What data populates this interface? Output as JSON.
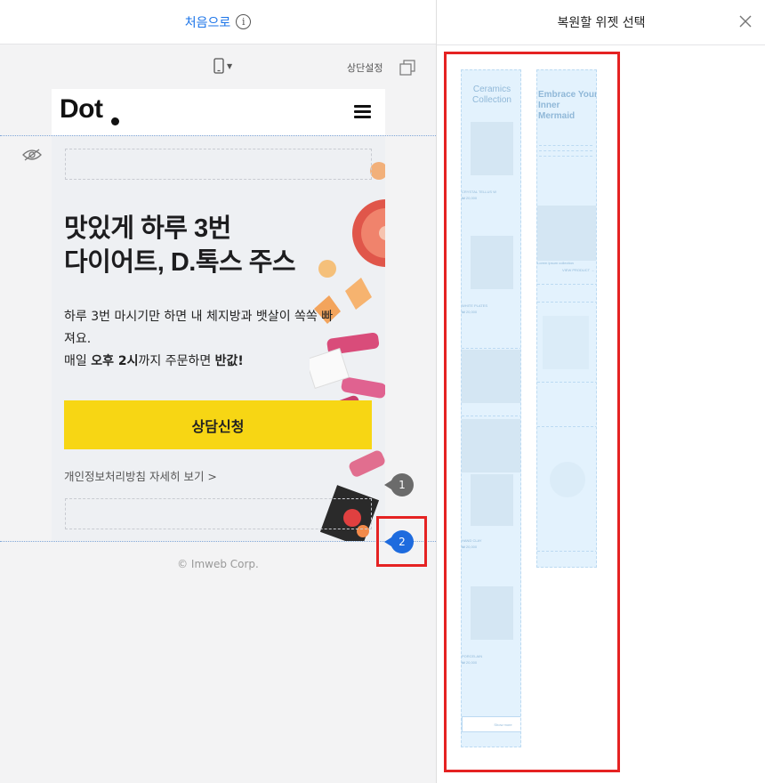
{
  "editor": {
    "start_label": "처음으로",
    "info_icon_glyph": "i",
    "device_icon": "mobile-phone-icon",
    "sticky_label": "상단설정",
    "copy_icon": "copy-icon"
  },
  "site": {
    "logo": "Dot",
    "menu_icon": "hamburger-menu-icon",
    "hero_title_line1": "맛있게 하루 3번",
    "hero_title_line2": "다이어트, D.톡스 주스",
    "desc_line1": "하루 3번 마시기만 하면 내 체지방과 뱃살이 쏙쏙 빠",
    "desc_line2": "져요.",
    "desc_line3_pre": "매일 ",
    "desc_line3_bold1": "오후 2시",
    "desc_line3_mid": "까지 주문하면 ",
    "desc_line3_bold2": "반값!",
    "cta_label": "상담신청",
    "privacy_link": "개인정보처리방침 자세히 보기 >",
    "footer": "© Imweb Corp."
  },
  "markers": {
    "first": "1",
    "second": "2"
  },
  "panel": {
    "title": "복원할 위젯 선택",
    "close_icon": "close-icon",
    "thumb1": {
      "title_line1": "Ceramics",
      "title_line2": "Collection",
      "item1": "CRYSTAL TELLUS W",
      "item1_price": "₩ 20,000",
      "item2": "WHITE PLATES",
      "item2_price": "₩ 20,000",
      "item3": "HAND CLAY",
      "item3_price": "₩ 20,000",
      "item4": "PORCELAIN",
      "item4_price": "₩ 20,000",
      "button": "Show more"
    },
    "thumb2": {
      "title_line1": "Embrace Your",
      "title_line2": "Inner",
      "title_line3": "Mermaid",
      "caption": "Lorem ipsum collection",
      "link": "VIEW PRODUCT →"
    }
  },
  "colors": {
    "accent": "#1e6bde",
    "highlight": "#e52222",
    "cta": "#f7d614",
    "thumb_bg": "#e3f2fd"
  }
}
